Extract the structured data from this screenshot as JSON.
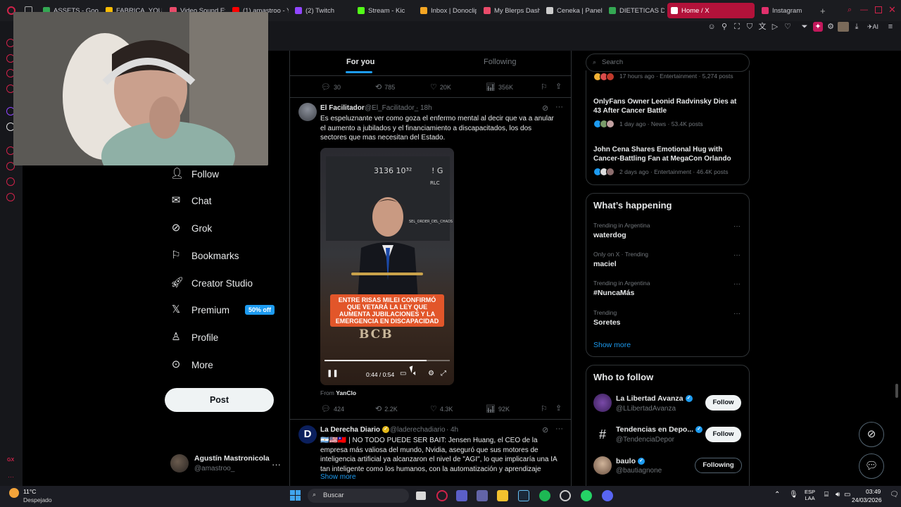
{
  "browser": {
    "tabs": [
      {
        "label": "ASSETS - Googl",
        "color": "#34a853"
      },
      {
        "label": "FABRICA_YOUT",
        "color": "#fbbc04"
      },
      {
        "label": "Video Sound Eff",
        "color": "#e94b6a"
      },
      {
        "label": "(1) amastroo - Y",
        "color": "#ff0000"
      },
      {
        "label": "(2) Twitch",
        "color": "#9146ff"
      },
      {
        "label": "Stream - Kic",
        "color": "#53fc18"
      },
      {
        "label": "Inbox | Donoclip",
        "color": "#f5a623"
      },
      {
        "label": "My Blerps Dash",
        "color": "#e94b6a"
      },
      {
        "label": "Ceneka | Panel",
        "color": "#cccccc"
      },
      {
        "label": "DIETETICAS DE",
        "color": "#34a853"
      },
      {
        "label": "Home / X",
        "color": "#ffffff"
      },
      {
        "label": "Instagram",
        "color": "#e1306c"
      }
    ],
    "accent": "#b3123a"
  },
  "nav": {
    "follow": "Follow",
    "chat": "Chat",
    "grok": "Grok",
    "bookmarks": "Bookmarks",
    "creator_studio": "Creator Studio",
    "premium": "Premium",
    "premium_badge": "50% off",
    "profile": "Profile",
    "more": "More",
    "post": "Post"
  },
  "account": {
    "name": "Agustín Mastronicola",
    "handle": "@amastroo_"
  },
  "timeline": {
    "tab_for_you": "For you",
    "tab_following": "Following",
    "prev_actions": {
      "replies": "30",
      "reposts": "785",
      "likes": "20K",
      "views": "356K"
    },
    "tweet1": {
      "name": "El Facilitador",
      "handle": "@El_Facilitador_",
      "time": "18h",
      "text": "Es espeluznante ver como goza el enfermo mental al decir que va a anular el aumento a jubilados y el financiamiento a discapacitados, los dos sectores que mas necesitan del Estado.",
      "video": {
        "caption": "ENTRE RISAS MILEI CONFIRMÓ QUE VETARÁ LA LEY QUE AUMENTA JUBILACIONES Y LA EMERGENCIA EN DISCAPACIDAD",
        "time": "0:44 / 0:54",
        "progress": 0.815,
        "board_text": [
          "3136 10³²",
          "! G",
          "RLC",
          "SEL_ORDER_DEL_CHAOS",
          "BCB"
        ]
      },
      "from_label": "From",
      "from_name": "YanClo",
      "actions": {
        "replies": "424",
        "reposts": "2.2K",
        "likes": "4.3K",
        "views": "92K"
      }
    },
    "tweet2": {
      "name": "La Derecha Diario",
      "handle": "@laderechadiario",
      "time": "4h",
      "text": "🇦🇷🇺🇸🇹🇼 | NO TODO PUEDE SER BAIT: Jensen Huang, el CEO de la empresa más valiosa del mundo, Nvidia, aseguró que sus motores de inteligencia artificial ya alcanzaron el nivel de \"AGI\", lo que implicaría una IA tan inteligente como los humanos, con la automatización y aprendizaje",
      "show_more": "Show more",
      "avatar_letter": "D"
    }
  },
  "sidebar": {
    "search_placeholder": "Search",
    "news": [
      {
        "meta": "17 hours ago · Entertainment · 5,274 posts"
      },
      {
        "title": "OnlyFans Owner Leonid Radvinsky Dies at 43 After Cancer Battle",
        "meta": "1 day ago · News · 53.4K posts"
      },
      {
        "title": "John Cena Shares Emotional Hug with Cancer-Battling Fan at MegaCon Orlando",
        "meta": "2 days ago · Entertainment · 46.4K posts"
      }
    ],
    "whats_happening_title": "What’s happening",
    "trends": [
      {
        "context": "Trending in Argentina",
        "name": "waterdog"
      },
      {
        "context": "Only on X · Trending",
        "name": "maciel"
      },
      {
        "context": "Trending in Argentina",
        "name": "#NuncaMás"
      },
      {
        "context": "Trending",
        "name": "Soretes"
      }
    ],
    "show_more": "Show more",
    "who_to_follow_title": "Who to follow",
    "follow_suggestions": [
      {
        "name": "La Libertad Avanza",
        "handle": "@LLibertadAvanza",
        "button": "Follow"
      },
      {
        "name": "Tendencias en Depo...",
        "handle": "@TendenciaDepor",
        "button": "Follow"
      },
      {
        "name": "baulo",
        "handle": "@bautiagnone",
        "button": "Following"
      }
    ]
  },
  "taskbar": {
    "temp": "11°C",
    "weather": "Despejado",
    "search": "Buscar",
    "lang_1": "ESP",
    "lang_2": "LAA",
    "time": "03:49",
    "date": "24/03/2026"
  }
}
